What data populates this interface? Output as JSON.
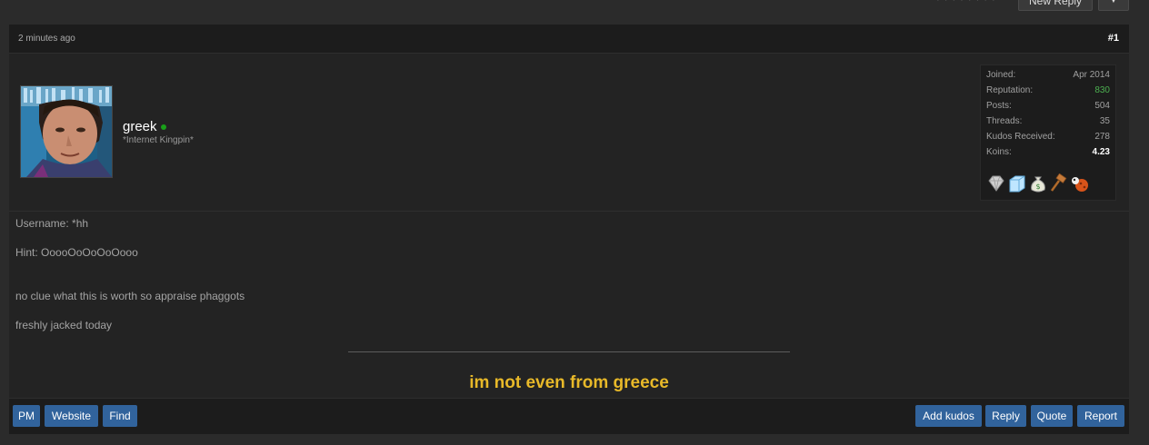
{
  "toolbar": {
    "pagination_text": "· · · · · · · ·",
    "new_reply_label": "New Reply",
    "more_label": "▼"
  },
  "post": {
    "timestamp": "2 minutes ago",
    "number": "#1",
    "author": {
      "username": "greek",
      "online": true,
      "title": "*Internet Kingpin*",
      "avatar_icon": "user-avatar-photo"
    },
    "stats": [
      {
        "label": "Joined:",
        "value": "Apr 2014"
      },
      {
        "label": "Reputation:",
        "value": "830"
      },
      {
        "label": "Posts:",
        "value": "504"
      },
      {
        "label": "Threads:",
        "value": "35"
      },
      {
        "label": "Kudos Received:",
        "value": "278"
      },
      {
        "label": "Koins:",
        "value": "4.23"
      }
    ],
    "awards": [
      "diamond-award-icon",
      "ice-cube-award-icon",
      "money-bag-award-icon",
      "gavel-award-icon",
      "ladybug-award-icon"
    ],
    "body": {
      "line1": "Username: *hh",
      "line2": "Hint: OoooOoOoOoOooo",
      "line3": "no clue what this is worth so appraise phaggots",
      "line4": "freshly jacked today"
    },
    "signature": "im not even from greece"
  },
  "footer": {
    "pm_label": "PM",
    "website_label": "Website",
    "find_label": "Find",
    "add_kudos_label": "Add kudos",
    "reply_label": "Reply",
    "quote_label": "Quote",
    "report_label": "Report"
  },
  "colors": {
    "accent_button": "#31639c",
    "signature": "#e8b929",
    "reputation": "#4caf50",
    "online": "#19a019"
  }
}
